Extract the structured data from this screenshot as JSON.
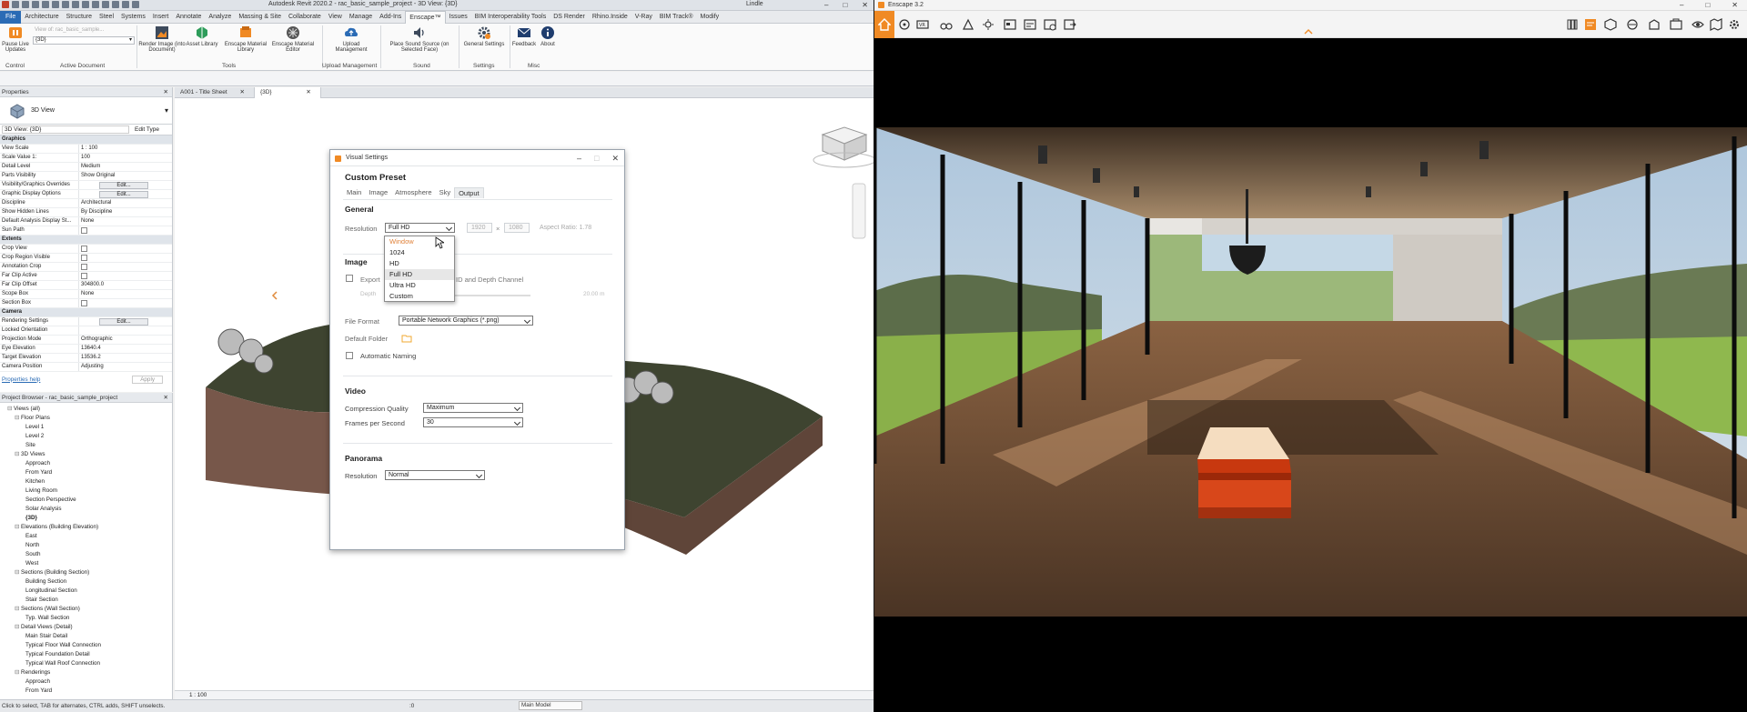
{
  "revit": {
    "title": "Autodesk Revit 2020.2 - rac_basic_sample_project - 3D View: {3D}",
    "user": "Lindle",
    "tabs": [
      "File",
      "Architecture",
      "Structure",
      "Steel",
      "Systems",
      "Insert",
      "Annotate",
      "Analyze",
      "Massing & Site",
      "Collaborate",
      "View",
      "Manage",
      "Add-Ins",
      "Enscape™",
      "Issues",
      "BIM Interoperability Tools",
      "DS Render",
      "Rhino.Inside",
      "V-Ray",
      "BIM Track®",
      "Modify"
    ],
    "active_tab": "Enscape™",
    "ribbon": {
      "pause": "Pause Live Updates",
      "view_select": "{3D}",
      "view_label": "View of: rac_basic_sample...",
      "render_image": "Render Image (into Document)",
      "asset_library": "Asset Library",
      "mat_library": "Enscape Material Library",
      "mat_editor": "Enscape Material Editor",
      "upload": "Upload Management",
      "place_sound": "Place Sound Source (on Selected Face)",
      "general": "General Settings",
      "feedback": "Feedback",
      "about": "About",
      "groups": {
        "control": "Control",
        "active": "Active Document",
        "tools": "Tools",
        "upload": "Upload Management",
        "sound": "Sound",
        "settings": "Settings",
        "misc": "Misc"
      }
    },
    "properties": {
      "header": "Properties",
      "type_name": "3D View",
      "instance": "3D View: {3D}",
      "edit_type": "Edit Type",
      "rows": [
        {
          "k": "Graphics",
          "v": "",
          "sec": true
        },
        {
          "k": "View Scale",
          "v": "1 : 100"
        },
        {
          "k": "Scale Value    1:",
          "v": "100"
        },
        {
          "k": "Detail Level",
          "v": "Medium"
        },
        {
          "k": "Parts Visibility",
          "v": "Show Original"
        },
        {
          "k": "Visibility/Graphics Overrides",
          "v": "Edit...",
          "btn": true
        },
        {
          "k": "Graphic Display Options",
          "v": "Edit...",
          "btn": true
        },
        {
          "k": "Discipline",
          "v": "Architectural"
        },
        {
          "k": "Show Hidden Lines",
          "v": "By Discipline"
        },
        {
          "k": "Default Analysis Display St...",
          "v": "None"
        },
        {
          "k": "Sun Path",
          "v": "",
          "chk": true
        },
        {
          "k": "Extents",
          "v": "",
          "sec": true
        },
        {
          "k": "Crop View",
          "v": "",
          "chk": true
        },
        {
          "k": "Crop Region Visible",
          "v": "",
          "chk": true
        },
        {
          "k": "Annotation Crop",
          "v": "",
          "chk": true
        },
        {
          "k": "Far Clip Active",
          "v": "",
          "chk": true
        },
        {
          "k": "Far Clip Offset",
          "v": "304800.0"
        },
        {
          "k": "Scope Box",
          "v": "None"
        },
        {
          "k": "Section Box",
          "v": "",
          "chk": true
        },
        {
          "k": "Camera",
          "v": "",
          "sec": true
        },
        {
          "k": "Rendering Settings",
          "v": "Edit...",
          "btn": true
        },
        {
          "k": "Locked Orientation",
          "v": ""
        },
        {
          "k": "Projection Mode",
          "v": "Orthographic"
        },
        {
          "k": "Eye Elevation",
          "v": "13640.4"
        },
        {
          "k": "Target Elevation",
          "v": "13536.2"
        },
        {
          "k": "Camera Position",
          "v": "Adjusting"
        }
      ],
      "help": "Properties help",
      "apply": "Apply"
    },
    "browser": {
      "header": "Project Browser - rac_basic_sample_project",
      "items": [
        {
          "t": "Views (all)",
          "l": 1
        },
        {
          "t": "Floor Plans",
          "l": 2
        },
        {
          "t": "Level 1",
          "l": 3
        },
        {
          "t": "Level 2",
          "l": 3
        },
        {
          "t": "Site",
          "l": 3
        },
        {
          "t": "3D Views",
          "l": 2
        },
        {
          "t": "Approach",
          "l": 3
        },
        {
          "t": "From Yard",
          "l": 3
        },
        {
          "t": "Kitchen",
          "l": 3
        },
        {
          "t": "Living Room",
          "l": 3
        },
        {
          "t": "Section Perspective",
          "l": 3
        },
        {
          "t": "Solar Analysis",
          "l": 3
        },
        {
          "t": "{3D}",
          "l": 3,
          "b": true
        },
        {
          "t": "Elevations (Building Elevation)",
          "l": 2
        },
        {
          "t": "East",
          "l": 3
        },
        {
          "t": "North",
          "l": 3
        },
        {
          "t": "South",
          "l": 3
        },
        {
          "t": "West",
          "l": 3
        },
        {
          "t": "Sections (Building Section)",
          "l": 2
        },
        {
          "t": "Building Section",
          "l": 3
        },
        {
          "t": "Longitudinal Section",
          "l": 3
        },
        {
          "t": "Stair Section",
          "l": 3
        },
        {
          "t": "Sections (Wall Section)",
          "l": 2
        },
        {
          "t": "Typ. Wall Section",
          "l": 3
        },
        {
          "t": "Detail Views (Detail)",
          "l": 2
        },
        {
          "t": "Main Stair Detail",
          "l": 3
        },
        {
          "t": "Typical Floor Wall Connection",
          "l": 3
        },
        {
          "t": "Typical Foundation Detail",
          "l": 3
        },
        {
          "t": "Typical Wall Roof Connection",
          "l": 3
        },
        {
          "t": "Renderings",
          "l": 2
        },
        {
          "t": "Approach",
          "l": 3
        },
        {
          "t": "From Yard",
          "l": 3
        }
      ]
    },
    "doc_tabs": [
      "A001 - Title Sheet",
      "{3D}"
    ],
    "status": {
      "hint": "Click to select, TAB for alternates, CTRL adds, SHIFT unselects.",
      "scale": "1 : 100",
      "model": "Main Model",
      "zero": ":0"
    }
  },
  "dialog": {
    "title": "Visual Settings",
    "preset": "Custom Preset",
    "tabs": [
      "Main",
      "Image",
      "Atmosphere",
      "Sky",
      "Output"
    ],
    "active_tab": "Output",
    "general": "General",
    "resolution_label": "Resolution",
    "resolution_value": "Full HD",
    "width": "1920",
    "height": "1080",
    "times": "×",
    "aspect": "Aspect Ratio: 1.78",
    "dropdown": [
      "Window",
      "1024",
      "HD",
      "Full HD",
      "Ultra HD",
      "Custom"
    ],
    "image": "Image",
    "export_label": "Export",
    "export_suffix": "ID and Depth Channel",
    "depth_label": "Depth",
    "depth_value": "20.00 m",
    "file_format_label": "File Format",
    "file_format_value": "Portable Network Graphics (*.png)",
    "default_folder": "Default Folder",
    "auto_naming": "Automatic Naming",
    "video": "Video",
    "compression_label": "Compression Quality",
    "compression_value": "Maximum",
    "fps_label": "Frames per Second",
    "fps_value": "30",
    "panorama": "Panorama",
    "pano_res_label": "Resolution",
    "pano_res_value": "Normal"
  },
  "enscape": {
    "title": "Enscape 3.2"
  },
  "colors": {
    "revit_blue": "#2a6bb5",
    "enscape_orange": "#f08a24",
    "dropdown_highlight": "#e0823a"
  }
}
